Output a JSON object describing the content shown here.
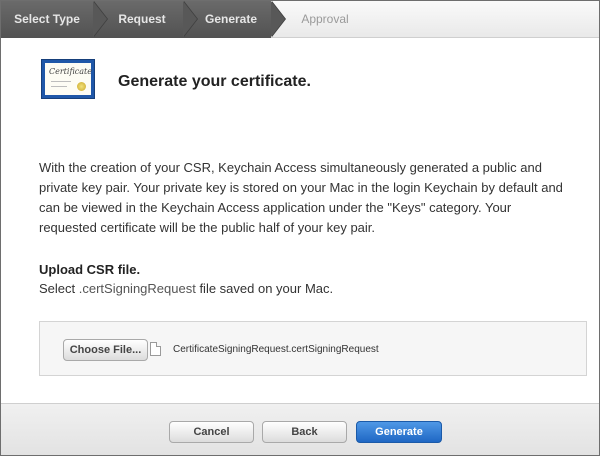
{
  "stepbar": {
    "steps": [
      {
        "label": "Select Type",
        "state": "done"
      },
      {
        "label": "Request",
        "state": "done"
      },
      {
        "label": "Generate",
        "state": "current"
      },
      {
        "label": "Approval",
        "state": "pending"
      }
    ]
  },
  "header": {
    "icon": "certificate-icon",
    "icon_text": "Certificate",
    "title": "Generate your certificate."
  },
  "description": "With the creation of your CSR, Keychain Access simultaneously generated a public and private key pair. Your private key is stored on your Mac in the login Keychain by default and can be viewed in the Keychain Access application under the \"Keys\" category. Your requested certificate will be the public half of your key pair.",
  "upload": {
    "title": "Upload CSR file.",
    "subtitle_prefix": "Select ",
    "subtitle_ext": ".certSigningRequest",
    "subtitle_suffix": " file saved on your Mac.",
    "choose_label": "Choose File...",
    "file_icon": "document-icon",
    "file_name": "CertificateSigningRequest.certSigningRequest"
  },
  "footer": {
    "cancel_label": "Cancel",
    "back_label": "Back",
    "generate_label": "Generate"
  },
  "colors": {
    "primary_button": "#1f67c4",
    "step_done": "#585858"
  }
}
